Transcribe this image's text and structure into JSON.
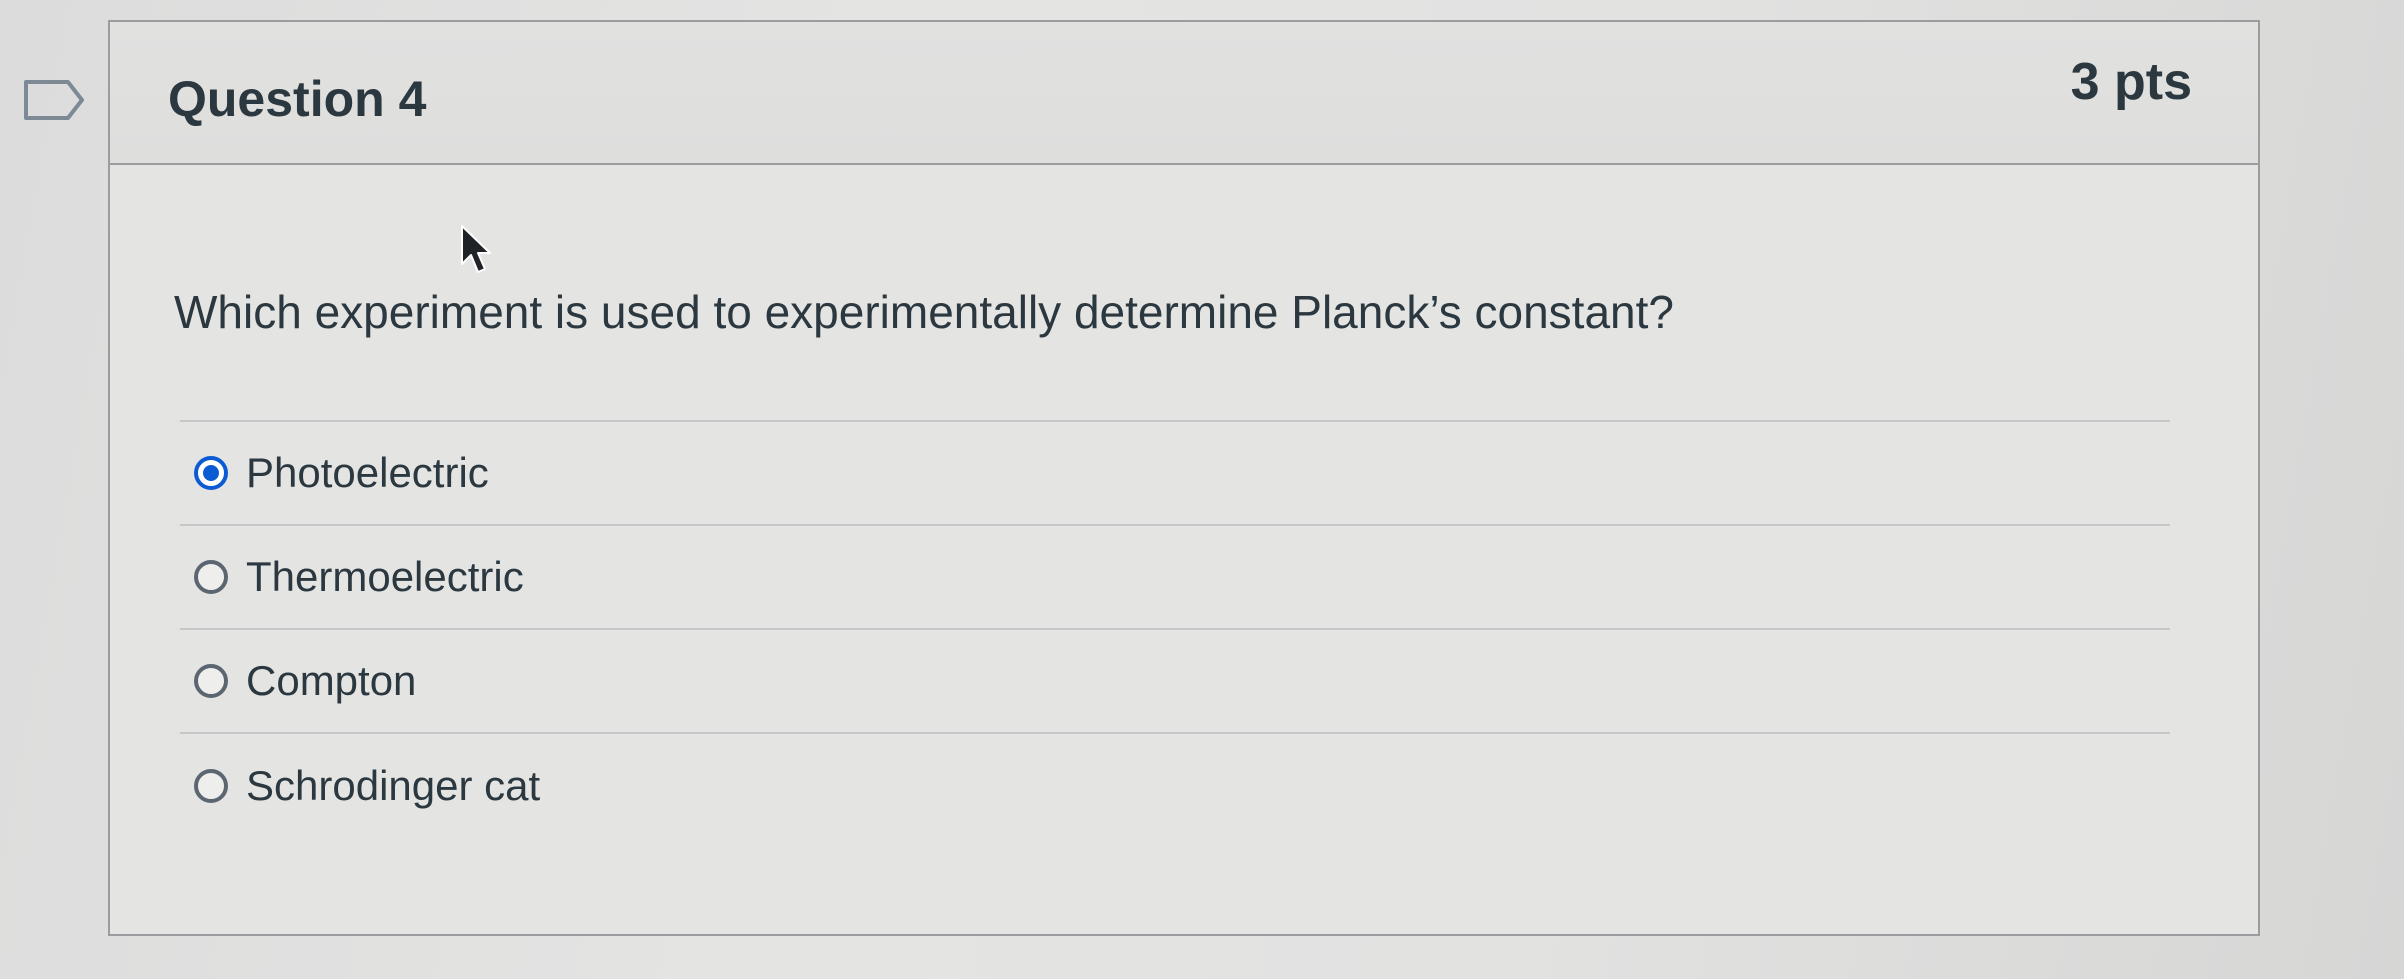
{
  "question": {
    "title": "Question 4",
    "points": "3 pts",
    "text": "Which experiment is used to experimentally determine Planck’s constant?",
    "answers": [
      {
        "label": "Photoelectric",
        "selected": true
      },
      {
        "label": "Thermoelectric",
        "selected": false
      },
      {
        "label": "Compton",
        "selected": false
      },
      {
        "label": "Schrodinger cat",
        "selected": false
      }
    ]
  },
  "icons": {
    "flag": "bookmark-flag-icon",
    "cursor": "mouse-pointer-icon"
  },
  "colors": {
    "accent": "#0b5bd3",
    "text": "#2b3840",
    "border": "#9a9c9e"
  }
}
